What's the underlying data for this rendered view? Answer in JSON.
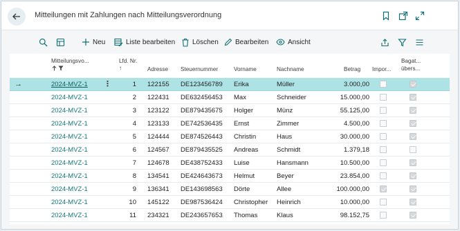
{
  "header": {
    "title": "Mitteilungen mit Zahlungen nach Mitteilungsverordnung"
  },
  "toolbar": {
    "new_label": "Neu",
    "edit_list_label": "Liste bearbeiten",
    "delete_label": "Löschen",
    "edit_label": "Bearbeiten",
    "view_label": "Ansicht"
  },
  "columns": {
    "mitteilung": "Mitteilungsvo...",
    "lfd_nr_1": "Lfd. Nr.",
    "lfd_nr_2": "↑",
    "adresse": "Adresse",
    "steuernummer": "Steuernummer",
    "vorname": "Vorname",
    "nachname": "Nachname",
    "betrag": "Betrag",
    "import": "Impor...",
    "bagatell_1": "Bagat...",
    "bagatell_2": "übers..."
  },
  "rows": [
    {
      "mitteilung": "2024-MVZ-1",
      "lfd": "1",
      "adresse": "122155",
      "steuernummer": "DE123456789",
      "vorname": "Erika",
      "nachname": "Müller",
      "betrag": "3.000,00",
      "import": false,
      "bagatell": true
    },
    {
      "mitteilung": "2024-MVZ-1",
      "lfd": "2",
      "adresse": "122431",
      "steuernummer": "DE632456453",
      "vorname": "Max",
      "nachname": "Schneider",
      "betrag": "15.000,00",
      "import": false,
      "bagatell": true
    },
    {
      "mitteilung": "2024-MVZ-1",
      "lfd": "3",
      "adresse": "123122",
      "steuernummer": "DE879435675",
      "vorname": "Holger",
      "nachname": "Münz",
      "betrag": "55.125,00",
      "import": false,
      "bagatell": true
    },
    {
      "mitteilung": "2024-MVZ-1",
      "lfd": "4",
      "adresse": "123133",
      "steuernummer": "DE742536435",
      "vorname": "Ernst",
      "nachname": "Zimmer",
      "betrag": "4.500,00",
      "import": false,
      "bagatell": true
    },
    {
      "mitteilung": "2024-MVZ-1",
      "lfd": "5",
      "adresse": "124444",
      "steuernummer": "DE874526443",
      "vorname": "Christin",
      "nachname": "Haus",
      "betrag": "30.000,00",
      "import": false,
      "bagatell": true
    },
    {
      "mitteilung": "2024-MVZ-1",
      "lfd": "6",
      "adresse": "124567",
      "steuernummer": "DE879435525",
      "vorname": "Andreas",
      "nachname": "Schmidt",
      "betrag": "1.379,18",
      "import": false,
      "bagatell": false
    },
    {
      "mitteilung": "2024-MVZ-1",
      "lfd": "7",
      "adresse": "124678",
      "steuernummer": "DE438752433",
      "vorname": "Luise",
      "nachname": "Hansmann",
      "betrag": "10.500,00",
      "import": false,
      "bagatell": true
    },
    {
      "mitteilung": "2024-MVZ-1",
      "lfd": "8",
      "adresse": "134541",
      "steuernummer": "DE424643673",
      "vorname": "Helmut",
      "nachname": "Beyer",
      "betrag": "23.854,00",
      "import": false,
      "bagatell": true
    },
    {
      "mitteilung": "2024-MVZ-1",
      "lfd": "9",
      "adresse": "136341",
      "steuernummer": "DE143698563",
      "vorname": "Dörte",
      "nachname": "Allee",
      "betrag": "100.000,00",
      "import": true,
      "bagatell": true
    },
    {
      "mitteilung": "2024-MVZ-1",
      "lfd": "10",
      "adresse": "145122",
      "steuernummer": "DE987536424",
      "vorname": "Christopher",
      "nachname": "Heinrich",
      "betrag": "10.000,00",
      "import": false,
      "bagatell": true
    },
    {
      "mitteilung": "2024-MVZ-1",
      "lfd": "11",
      "adresse": "234321",
      "steuernummer": "DE243657653",
      "vorname": "Thomas",
      "nachname": "Klaus",
      "betrag": "98.152,75",
      "import": false,
      "bagatell": true
    }
  ],
  "selected_row": 0,
  "colors": {
    "selected_row": "#aee3e6",
    "link": "#14777a",
    "accent": "#0f6f73"
  }
}
